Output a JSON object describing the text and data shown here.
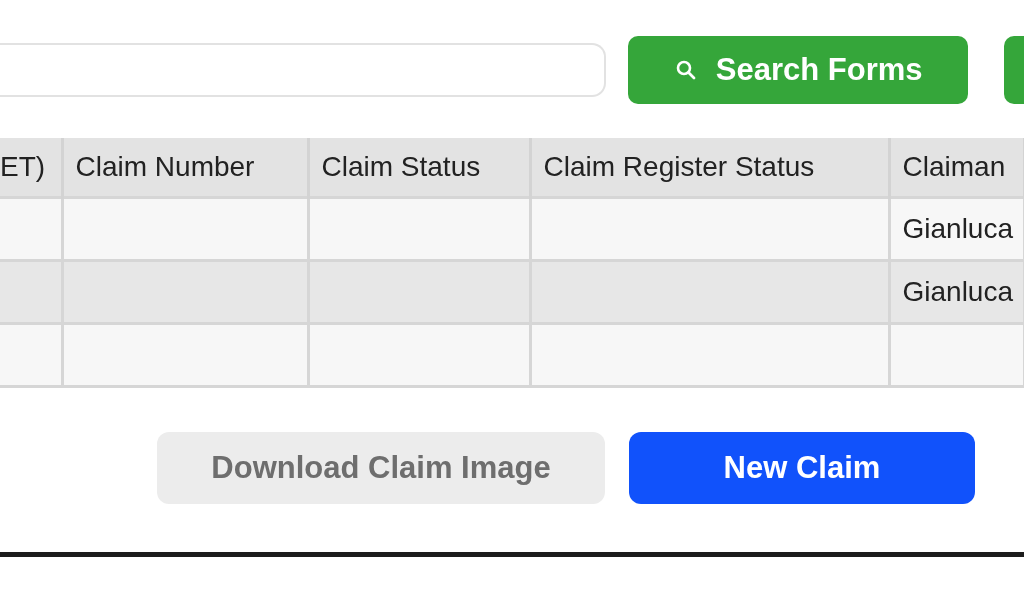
{
  "search": {
    "button": "Search Forms"
  },
  "table": {
    "columns": [
      "ET)",
      "Claim Number",
      "Claim Status",
      "Claim Register Status",
      "Claiman"
    ],
    "rows": [
      [
        "",
        "",
        "",
        "",
        "Gianluca"
      ],
      [
        "",
        "",
        "",
        "",
        "Gianluca"
      ],
      [
        "",
        "",
        "",
        "",
        ""
      ]
    ]
  },
  "buttons": [
    {
      "label": "Download Claim Image",
      "disabled": true
    },
    {
      "label": "New Claim",
      "disabled": false
    }
  ]
}
